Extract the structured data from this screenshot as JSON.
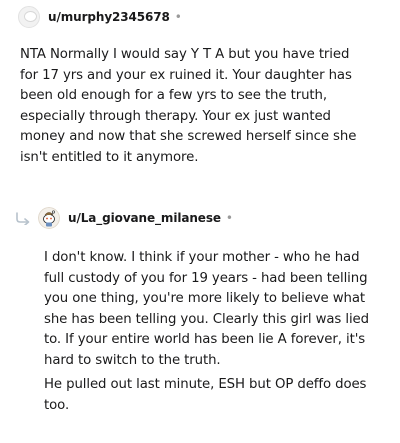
{
  "comments": [
    {
      "username": "u/murphy2345678",
      "separator": "•",
      "avatar_icon": "default-avatar-icon",
      "body": [
        "NTA Normally I would say Y T A but you have tried for 17 yrs and your ex ruined it. Your daughter has been old enough for a few yrs to see the truth, especially through therapy. Your ex just wanted money and now that she screwed herself since she isn't entitled to it anymore."
      ]
    },
    {
      "username": "u/La_giovane_milanese",
      "separator": "•",
      "avatar_icon": "snoo-avatar-icon",
      "reply_icon": "reply-arrow-icon",
      "body": [
        "I don't know. I think if your mother - who he had full custody of you for 19 years - had been telling you one thing, you're more likely to believe what she has been telling you. Clearly this girl was lied to. If your entire world has been lie A forever, it's hard to switch to the truth.",
        "He pulled out last minute, ESH but OP deffo does too."
      ]
    }
  ],
  "colors": {
    "text": "#1a1a1b",
    "muted": "#9a9a9a",
    "reply_arrow": "#b7c2cc"
  }
}
